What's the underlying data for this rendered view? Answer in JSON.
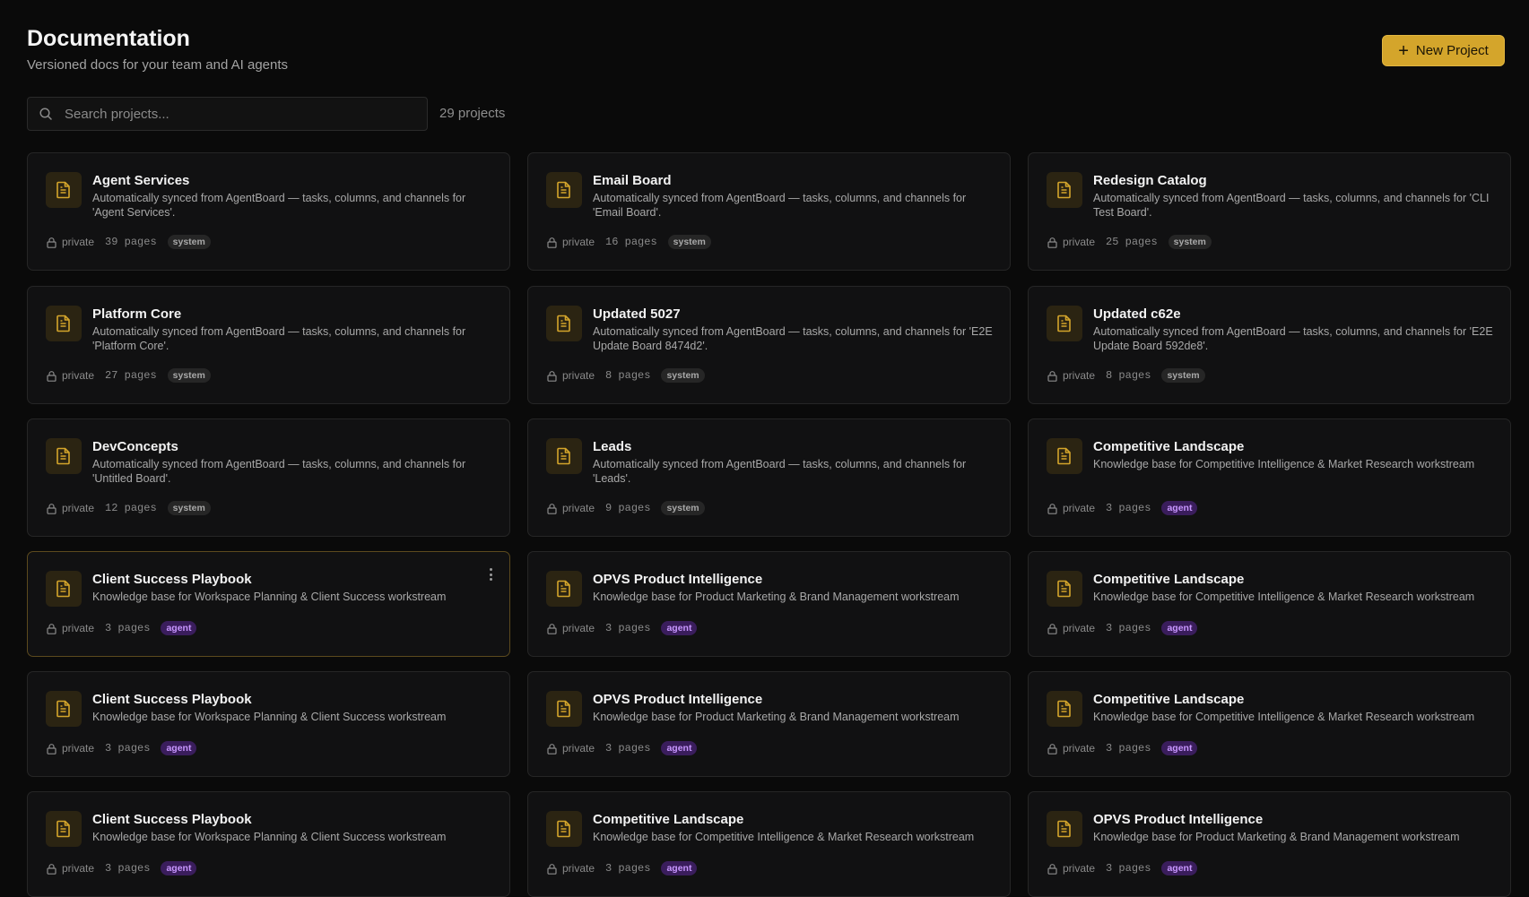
{
  "header": {
    "title": "Documentation",
    "subtitle": "Versioned docs for your team and AI agents",
    "new_project_label": "New Project"
  },
  "search": {
    "placeholder": "Search projects...",
    "count_label": "29 projects"
  },
  "icons": {
    "search": "search-icon",
    "plus": "plus-icon",
    "doc": "document-icon",
    "lock": "lock-icon",
    "more": "more-vertical-icon"
  },
  "colors": {
    "accent": "#d4a52b",
    "agent_tag": "#c896ff",
    "system_tag": "#a8a8a8",
    "background": "#0a0a0a"
  },
  "projects": [
    {
      "title": "Agent Services",
      "desc": "Automatically synced from AgentBoard — tasks, columns, and channels for 'Agent Services'.",
      "visibility": "private",
      "pages": "39 pages",
      "tag": "system"
    },
    {
      "title": "Email Board",
      "desc": "Automatically synced from AgentBoard — tasks, columns, and channels for 'Email Board'.",
      "visibility": "private",
      "pages": "16 pages",
      "tag": "system"
    },
    {
      "title": "Redesign Catalog",
      "desc": "Automatically synced from AgentBoard — tasks, columns, and channels for 'CLI Test Board'.",
      "visibility": "private",
      "pages": "25 pages",
      "tag": "system"
    },
    {
      "title": "Platform Core",
      "desc": "Automatically synced from AgentBoard — tasks, columns, and channels for 'Platform Core'.",
      "visibility": "private",
      "pages": "27 pages",
      "tag": "system"
    },
    {
      "title": "Updated 5027",
      "desc": "Automatically synced from AgentBoard — tasks, columns, and channels for 'E2E Update Board 8474d2'.",
      "visibility": "private",
      "pages": "8 pages",
      "tag": "system"
    },
    {
      "title": "Updated c62e",
      "desc": "Automatically synced from AgentBoard — tasks, columns, and channels for 'E2E Update Board 592de8'.",
      "visibility": "private",
      "pages": "8 pages",
      "tag": "system"
    },
    {
      "title": "DevConcepts",
      "desc": "Automatically synced from AgentBoard — tasks, columns, and channels for 'Untitled Board'.",
      "visibility": "private",
      "pages": "12 pages",
      "tag": "system"
    },
    {
      "title": "Leads",
      "desc": "Automatically synced from AgentBoard — tasks, columns, and channels for 'Leads'.",
      "visibility": "private",
      "pages": "9 pages",
      "tag": "system"
    },
    {
      "title": "Competitive Landscape",
      "desc": "Knowledge base for Competitive Intelligence & Market Research workstream",
      "visibility": "private",
      "pages": "3 pages",
      "tag": "agent"
    },
    {
      "title": "Client Success Playbook",
      "desc": "Knowledge base for Workspace Planning & Client Success workstream",
      "visibility": "private",
      "pages": "3 pages",
      "tag": "agent"
    },
    {
      "title": "OPVS Product Intelligence",
      "desc": "Knowledge base for Product Marketing & Brand Management workstream",
      "visibility": "private",
      "pages": "3 pages",
      "tag": "agent"
    },
    {
      "title": "Competitive Landscape",
      "desc": "Knowledge base for Competitive Intelligence & Market Research workstream",
      "visibility": "private",
      "pages": "3 pages",
      "tag": "agent"
    },
    {
      "title": "Client Success Playbook",
      "desc": "Knowledge base for Workspace Planning & Client Success workstream",
      "visibility": "private",
      "pages": "3 pages",
      "tag": "agent"
    },
    {
      "title": "OPVS Product Intelligence",
      "desc": "Knowledge base for Product Marketing & Brand Management workstream",
      "visibility": "private",
      "pages": "3 pages",
      "tag": "agent"
    },
    {
      "title": "Competitive Landscape",
      "desc": "Knowledge base for Competitive Intelligence & Market Research workstream",
      "visibility": "private",
      "pages": "3 pages",
      "tag": "agent"
    },
    {
      "title": "Client Success Playbook",
      "desc": "Knowledge base for Workspace Planning & Client Success workstream",
      "visibility": "private",
      "pages": "3 pages",
      "tag": "agent"
    },
    {
      "title": "Competitive Landscape",
      "desc": "Knowledge base for Competitive Intelligence & Market Research workstream",
      "visibility": "private",
      "pages": "3 pages",
      "tag": "agent"
    },
    {
      "title": "OPVS Product Intelligence",
      "desc": "Knowledge base for Product Marketing & Brand Management workstream",
      "visibility": "private",
      "pages": "3 pages",
      "tag": "agent"
    }
  ]
}
